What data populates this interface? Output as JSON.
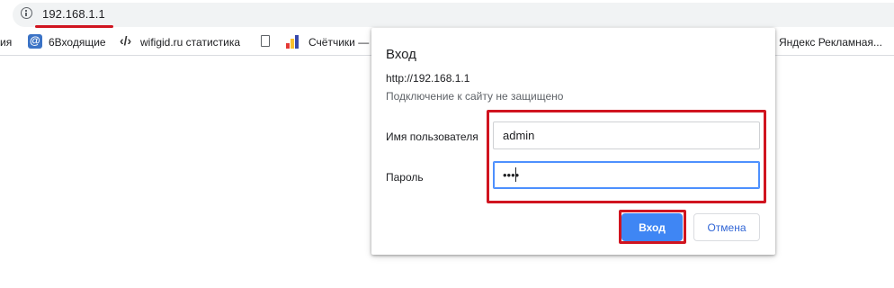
{
  "address_bar": {
    "url": "192.168.1.1",
    "info_icon": "info-icon"
  },
  "bookmarks": {
    "items": [
      {
        "label": "ия",
        "icon": "none"
      },
      {
        "label": "6Входящие",
        "icon": "mail-icon"
      },
      {
        "label": "wifigid.ru  статистика",
        "icon": "code-icon"
      },
      {
        "label": "",
        "icon": "document-icon"
      },
      {
        "label": "Счётчики —",
        "icon": "counter-icon"
      },
      {
        "label": "Яндекс Рекламная...",
        "icon": "none"
      }
    ]
  },
  "dialog": {
    "title": "Вход",
    "url": "http://192.168.1.1",
    "warning": "Подключение к сайту не защищено",
    "username_label": "Имя пользователя",
    "username_value": "admin",
    "password_label": "Пароль",
    "password_value": "••••",
    "login_button": "Вход",
    "cancel_button": "Отмена"
  },
  "colors": {
    "highlight": "#d0141f",
    "primary_button": "#3f86f4",
    "secondary_text": "#3367d6"
  }
}
